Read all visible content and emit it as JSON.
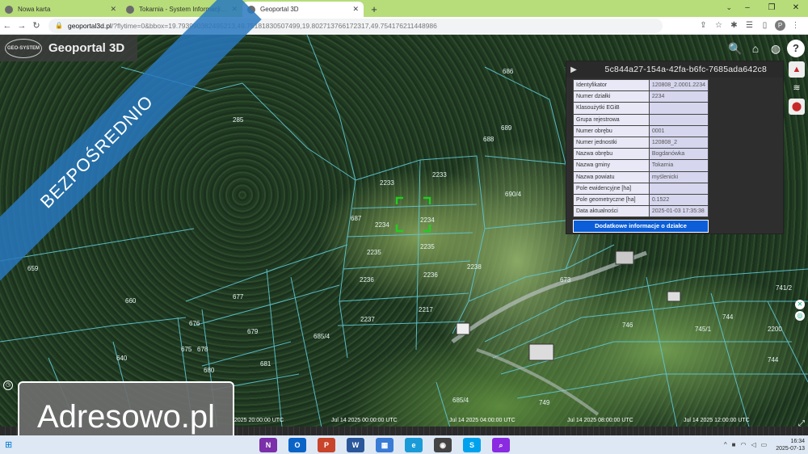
{
  "browser": {
    "tabs": [
      {
        "title": "Nowa karta"
      },
      {
        "title": "Tokarnia - System Informacji Prze"
      },
      {
        "title": "Geoportal 3D"
      }
    ],
    "new_tab": "+",
    "url_host": "geoportal3d.pl",
    "url_rest": "/?flytime=0&bbox=19.793990382495213,49.75181830507499,19.802713766172317,49.754176211448986"
  },
  "app": {
    "logo": "GEO-SYSTEM",
    "title": "Geoportal 3D",
    "ribbon": "BEZPOŚREDNIO"
  },
  "panel": {
    "parcel_id": "5c844a27-154a-42fa-b6fc-7685ada642c8",
    "rows": [
      {
        "key": "Identyfikator",
        "value": "120808_2.0001.2234"
      },
      {
        "key": "Numer działki",
        "value": "2234"
      },
      {
        "key": "Klasoużytki EGiB",
        "value": ""
      },
      {
        "key": "Grupa rejestrowa",
        "value": ""
      },
      {
        "key": "Numer obrębu",
        "value": "0001"
      },
      {
        "key": "Numer jednostki",
        "value": "120808_2"
      },
      {
        "key": "Nazwa obrębu",
        "value": "Bogdanówka"
      },
      {
        "key": "Nazwa gminy",
        "value": "Tokarnia"
      },
      {
        "key": "Nazwa powiatu",
        "value": "myślenicki"
      },
      {
        "key": "Pole ewidencyjne [ha]",
        "value": ""
      },
      {
        "key": "Pole geometryczne [ha]",
        "value": "0.1522"
      },
      {
        "key": "Data aktualności",
        "value": "2025-01-03 17:35:38"
      }
    ],
    "button": "Dodatkowe informacje o działce"
  },
  "map_labels": [
    {
      "text": "2233"
    },
    {
      "text": "2233"
    },
    {
      "text": "2234"
    },
    {
      "text": "2234"
    },
    {
      "text": "2235"
    },
    {
      "text": "2235"
    },
    {
      "text": "2236"
    },
    {
      "text": "2236"
    },
    {
      "text": "2237"
    },
    {
      "text": "2217"
    },
    {
      "text": "2238"
    },
    {
      "text": "687"
    },
    {
      "text": "685/4"
    },
    {
      "text": "685/4"
    },
    {
      "text": "690/4"
    },
    {
      "text": "689"
    },
    {
      "text": "688"
    },
    {
      "text": "673"
    },
    {
      "text": "746"
    },
    {
      "text": "744"
    },
    {
      "text": "744"
    },
    {
      "text": "745/1"
    },
    {
      "text": "741/2"
    },
    {
      "text": "2200"
    },
    {
      "text": "749"
    },
    {
      "text": "677"
    },
    {
      "text": "679"
    },
    {
      "text": "681"
    },
    {
      "text": "676"
    },
    {
      "text": "678"
    },
    {
      "text": "675"
    },
    {
      "text": "680"
    },
    {
      "text": "660"
    },
    {
      "text": "659"
    },
    {
      "text": "640"
    },
    {
      "text": "285"
    },
    {
      "text": "686"
    }
  ],
  "timeline": {
    "labels": [
      {
        "text": "2025 20:00:00 UTC"
      },
      {
        "text": "Jul 14 2025 00:00:00 UTC"
      },
      {
        "text": "Jul 14 2025 04:00:00 UTC"
      },
      {
        "text": "Jul 14 2025 08:00:00 UTC"
      },
      {
        "text": "Jul 14 2025 12:00:00 UTC"
      }
    ]
  },
  "watermark": "Adresowo.pl",
  "taskbar": {
    "time": "16:34",
    "date": "2025-07-13"
  },
  "colors": {
    "tabbar": "#b7dd7a",
    "ribbon": "#2878be",
    "button": "#0b5ed7",
    "parcel_line": "#5fc7d6",
    "selection": "#22cc22"
  }
}
